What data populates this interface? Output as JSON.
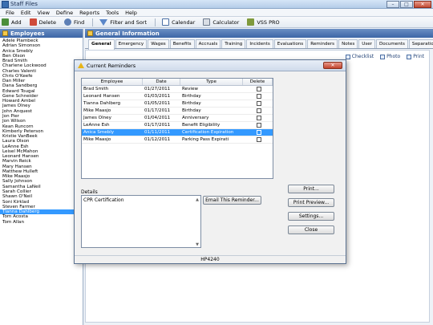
{
  "window": {
    "title": "Staff Files",
    "min": "–",
    "max": "□",
    "close": "✕"
  },
  "menu": [
    "File",
    "Edit",
    "View",
    "Define",
    "Reports",
    "Tools",
    "Help"
  ],
  "toolbar": {
    "add": "Add",
    "delete": "Delete",
    "find": "Find",
    "filter": "Filter and Sort",
    "calendar": "Calendar",
    "calculator": "Calculator",
    "vss": "VSS PRO"
  },
  "employees_panel": {
    "title": "Employees",
    "items": [
      "Adele Plambeck",
      "Adrian Simonson",
      "Anica Smebly",
      "Ben Olson",
      "Brad Smith",
      "Charlene Lockwood",
      "Charles Valenti",
      "Chris O'Keefe",
      "Dan Miller",
      "Dana Sandberg",
      "Edward Tougal",
      "Gene Schneider",
      "Howard Ambel",
      "James Olney",
      "John Anquest",
      "Jon Pier",
      "Jon Wilson",
      "Kean Runcorn",
      "Kimberly Peterson",
      "Kristie VanBeek",
      "Laura Olson",
      "LeAnne Esh",
      "Leisel McMahon",
      "Leonard Hansen",
      "Marvin Reick",
      "Mary Hansen",
      "Matthew Hulleft",
      "Mike Maasjo",
      "Sally Johnson",
      "Samantha LaNeil",
      "Sarah Collier",
      "Shawn O'Neil",
      "Soni Kirklad",
      "Steven Farmer",
      "Tianna Dahlberg",
      "Tom Acosta",
      "Tom Allan"
    ],
    "selected": "Tianna Dahlberg"
  },
  "general_info": {
    "title": "General Information",
    "tabs": [
      "General",
      "Emergency",
      "Wages",
      "Benefits",
      "Accruals",
      "Training",
      "Incidents",
      "Evaluations",
      "Reminders",
      "Notes",
      "User",
      "Documents",
      "Separation"
    ],
    "active_tab": "General",
    "actions": {
      "checklist": "Checklist",
      "photo": "Photo",
      "print": "Print"
    }
  },
  "dialog": {
    "title": "Current Reminders",
    "columns": [
      "Employee",
      "Date",
      "Type",
      "Delete"
    ],
    "rows": [
      {
        "employee": "Brad Smith",
        "date": "01/27/2011",
        "type": "Review",
        "selected": false
      },
      {
        "employee": "Leonard Hansen",
        "date": "01/03/2011",
        "type": "Birthday",
        "selected": false
      },
      {
        "employee": "Tianna Dahlberg",
        "date": "01/05/2011",
        "type": "Birthday",
        "selected": false
      },
      {
        "employee": "Mike Maasjo",
        "date": "01/17/2011",
        "type": "Birthday",
        "selected": false
      },
      {
        "employee": "James Olney",
        "date": "01/04/2011",
        "type": "Anniversary",
        "selected": false
      },
      {
        "employee": "LeAnne Esh",
        "date": "01/17/2011",
        "type": "Benefit Eligibility",
        "selected": false
      },
      {
        "employee": "Anica Smebly",
        "date": "01/11/2011",
        "type": "Certification Expiration",
        "selected": true
      },
      {
        "employee": "Mike Maasjo",
        "date": "01/12/2011",
        "type": "Parking Pass Expirati",
        "selected": false
      }
    ],
    "details_label": "Details",
    "details_text": "CPR Certification",
    "buttons": {
      "email": "Email This Reminder...",
      "print": "Print...",
      "preview": "Print Preview...",
      "settings": "Settings...",
      "close": "Close"
    },
    "status": "HP4240"
  }
}
